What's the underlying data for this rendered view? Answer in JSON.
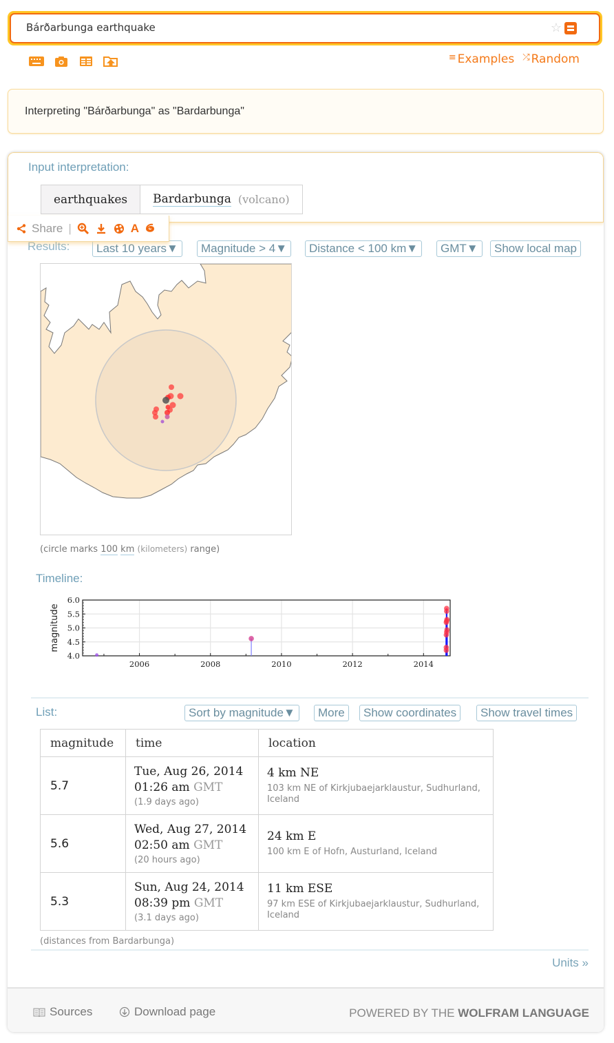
{
  "search": {
    "query": "Bárðarbunga earthquake",
    "star_icon": "star-icon",
    "submit_icon": "equals-icon"
  },
  "tools": [
    {
      "icon": "keyboard-icon"
    },
    {
      "icon": "camera-icon"
    },
    {
      "icon": "table-icon"
    },
    {
      "icon": "upload-folder-icon"
    }
  ],
  "links": {
    "examples": "Examples",
    "random": "Random"
  },
  "assumption": {
    "text": "Interpreting \"Bárðarbunga\" as \"Bardarbunga\""
  },
  "input_interpretation": {
    "title": "Input interpretation:",
    "property": "earthquakes",
    "entity": "Bardarbunga",
    "entity_type": "(volcano)"
  },
  "share": {
    "label": "Share",
    "separator": "|",
    "icons": [
      "zoom-in-icon",
      "download-icon",
      "palette-icon",
      "text-icon",
      "spiral-icon"
    ]
  },
  "results": {
    "label": "Results:",
    "options": [
      "Last 10 years▼",
      "Magnitude > 4▼",
      "Distance < 100 km▼",
      "GMT▼",
      "Show local map"
    ],
    "map_caption": {
      "prefix": "(circle marks",
      "value": "100",
      "unit": "km",
      "unit_long": "(kilometers)",
      "suffix": "range)"
    }
  },
  "timeline": {
    "label": "Timeline:"
  },
  "chart_data": {
    "type": "scatter",
    "title": "",
    "xlabel": "",
    "ylabel": "magnitude",
    "xlim": [
      2004.4,
      2014.75
    ],
    "ylim": [
      4.0,
      6.0
    ],
    "x_ticks": [
      2006,
      2008,
      2010,
      2012,
      2014
    ],
    "y_ticks": [
      4.0,
      4.5,
      5.0,
      5.5,
      6.0
    ],
    "grid": true,
    "points": [
      {
        "x": 2004.8,
        "y": 4.03,
        "color": "#9b4be6"
      },
      {
        "x": 2009.15,
        "y": 4.62,
        "color": "#d1338a"
      },
      {
        "x": 2014.64,
        "y": 4.2,
        "color": "#ff3344"
      },
      {
        "x": 2014.64,
        "y": 4.3,
        "color": "#ff3344"
      },
      {
        "x": 2014.64,
        "y": 4.75,
        "color": "#ff3344"
      },
      {
        "x": 2014.65,
        "y": 4.85,
        "color": "#ff3344"
      },
      {
        "x": 2014.66,
        "y": 4.93,
        "color": "#ff3344"
      },
      {
        "x": 2014.64,
        "y": 5.2,
        "color": "#ff3344"
      },
      {
        "x": 2014.65,
        "y": 5.25,
        "color": "#ff3344"
      },
      {
        "x": 2014.66,
        "y": 5.3,
        "color": "#ff3344"
      },
      {
        "x": 2014.65,
        "y": 5.6,
        "color": "#ff3344"
      },
      {
        "x": 2014.65,
        "y": 5.7,
        "color": "#ff3344"
      }
    ]
  },
  "list": {
    "label": "List:",
    "buttons": [
      "Sort by magnitude▼",
      "More",
      "Show coordinates",
      "Show travel times"
    ],
    "columns": [
      "magnitude",
      "time",
      "location"
    ],
    "rows": [
      {
        "magnitude": "5.7",
        "date": "Tue, Aug 26, 2014",
        "clock": "01:26 am",
        "tz": "GMT",
        "ago": "(1.9 days ago)",
        "location": "4 km NE",
        "detail": "103 km NE of Kirkjubaejarklaustur, Sudhurland, Iceland"
      },
      {
        "magnitude": "5.6",
        "date": "Wed, Aug 27, 2014",
        "clock": "02:50 am",
        "tz": "GMT",
        "ago": "(20 hours ago)",
        "location": "24 km E",
        "detail": "100 km E of Hofn, Austurland, Iceland"
      },
      {
        "magnitude": "5.3",
        "date": "Sun, Aug 24, 2014",
        "clock": "08:39 pm",
        "tz": "GMT",
        "ago": "(3.1 days ago)",
        "location": "11 km ESE",
        "detail": "97 km ESE of Kirkjubaejarklaustur, Sudhurland, Iceland"
      }
    ],
    "note": "(distances from Bardarbunga)"
  },
  "units_link": "Units »",
  "footer": {
    "sources": "Sources",
    "download": "Download page",
    "powered_prefix": "POWERED BY THE",
    "powered_brand": "WOLFRAM LANGUAGE"
  },
  "colors": {
    "accent": "#f26a10",
    "link_blue": "#6f9fb7",
    "land": "#fdebd0",
    "quake_recent": "#ff3344",
    "volcano": "#555555"
  }
}
